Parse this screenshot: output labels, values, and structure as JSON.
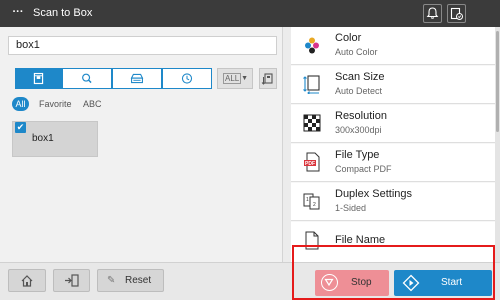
{
  "header": {
    "menu_label": "···",
    "title": "Scan to Box",
    "icons": [
      "bell-icon",
      "device-icon"
    ]
  },
  "left": {
    "box_name": "box1",
    "tabs": [
      {
        "icon": "box-icon",
        "selected": true
      },
      {
        "icon": "search-icon",
        "selected": false
      },
      {
        "icon": "scanner-icon",
        "selected": false
      },
      {
        "icon": "clock-icon",
        "selected": false
      }
    ],
    "dropdown_value": "ALL",
    "filters": [
      "All",
      "Favorite",
      "ABC"
    ],
    "selected_filter": "All",
    "boxes": [
      {
        "label": "box1",
        "checked": true,
        "check_glyph": "✔"
      }
    ]
  },
  "settings": [
    {
      "title": "Color",
      "value": "Auto Color",
      "icon": "color-icon"
    },
    {
      "title": "Scan Size",
      "value": "Auto Detect",
      "icon": "scan-size-icon"
    },
    {
      "title": "Resolution",
      "value": "300x300dpi",
      "icon": "resolution-icon"
    },
    {
      "title": "File Type",
      "value": "Compact PDF",
      "icon": "pdf-icon"
    },
    {
      "title": "Duplex Settings",
      "value": "1-Sided",
      "icon": "duplex-icon"
    },
    {
      "title": "File Name",
      "value": "",
      "icon": "file-icon"
    }
  ],
  "footer": {
    "reset_label": "Reset",
    "reset_icon_glyph": "✎",
    "stop_label": "Stop",
    "start_label": "Start"
  },
  "colors": {
    "accent": "#1e88c9",
    "stop": "#ee8f96",
    "highlight": "#e51b1b",
    "topbar": "#3b3b3b"
  }
}
